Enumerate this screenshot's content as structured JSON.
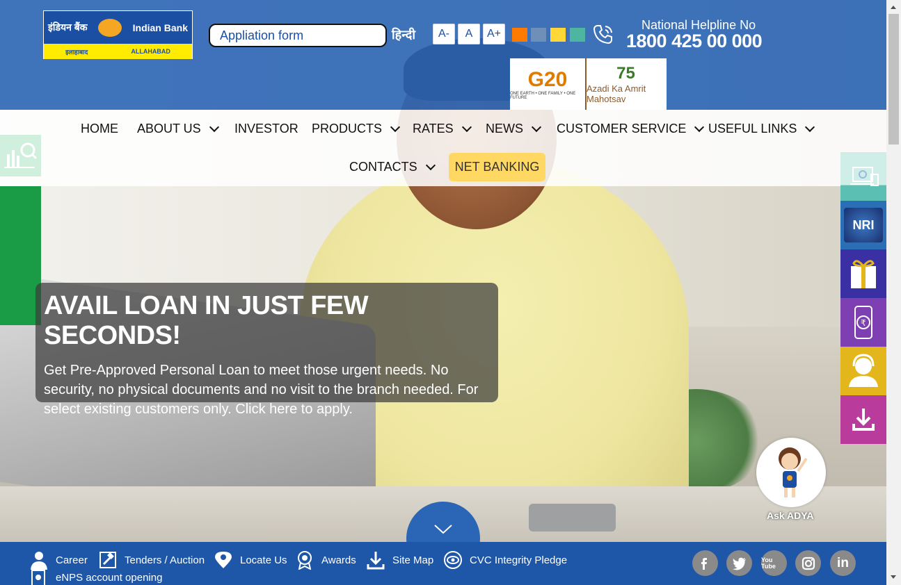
{
  "logo": {
    "hindi_name": "इंडियन बैंक",
    "english_name": "Indian Bank",
    "sub_hindi": "इलाहाबाद",
    "sub_english": "ALLAHABAD"
  },
  "search": {
    "value": "Appliation form"
  },
  "language_toggle": "हिन्दी",
  "font_size": {
    "decrease": "A-",
    "normal": "A",
    "increase": "A+"
  },
  "color_themes": [
    "#ff7a00",
    "#6e8fb8",
    "#ffd838",
    "#4db5a0"
  ],
  "helpline": {
    "label": "National Helpline No",
    "number": "1800 425 00 000"
  },
  "badges": {
    "g20": "G20",
    "g20_sub": "ONE EARTH • ONE FAMILY • ONE FUTURE",
    "azadi_num": "75",
    "azadi": "Azadi Ka Amrit Mahotsav"
  },
  "nav": {
    "items": [
      {
        "label": "HOME"
      },
      {
        "label": "ABOUT US"
      },
      {
        "label": "INVESTOR"
      },
      {
        "label": "PRODUCTS"
      },
      {
        "label": "RATES"
      },
      {
        "label": "NEWS"
      },
      {
        "label": "CUSTOMER SERVICE"
      },
      {
        "label": "USEFUL LINKS"
      },
      {
        "label": "CONTACTS"
      }
    ],
    "net_banking": "NET BANKING"
  },
  "banner": {
    "title": "AVAIL LOAN IN JUST FEW SECONDS!",
    "text": "Get Pre-Approved Personal Loan to meet those urgent needs. No security, no physical documents and no visit to the branch needed. For select existing customers only. Click here to apply."
  },
  "side_panel": {
    "colors": [
      "#5bc0b3",
      "#2a6fb5",
      "#3a2fa3",
      "#7e3fb2",
      "#e3b61c",
      "#b93b9c"
    ],
    "icons": [
      "digital-banking-icon",
      "nri-icon",
      "gift-icon",
      "mobile-rupee-icon",
      "customer-support-icon",
      "download-icon"
    ],
    "nri_text": "NRI"
  },
  "assistant": {
    "label": "Ask ADYA"
  },
  "footer": {
    "links": [
      "Career",
      "Tenders / Auction",
      "Locate Us",
      "Awards",
      "Site Map",
      "CVC Integrity Pledge",
      "eNPS account opening"
    ],
    "social": [
      "f",
      "t",
      "You Tube",
      "ig",
      "in"
    ]
  }
}
